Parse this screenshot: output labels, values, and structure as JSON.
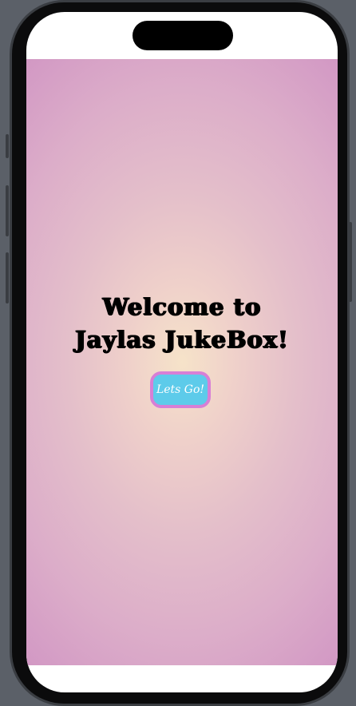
{
  "screen": {
    "title_line1": "Welcome to",
    "title_line2": "Jaylas JukeBox!",
    "go_button_label": "Lets Go!"
  },
  "colors": {
    "button_fill": "#5dcbea",
    "button_border": "#d77fd6",
    "gradient_center": "#f6e3c9",
    "gradient_edge": "#c78abb"
  }
}
